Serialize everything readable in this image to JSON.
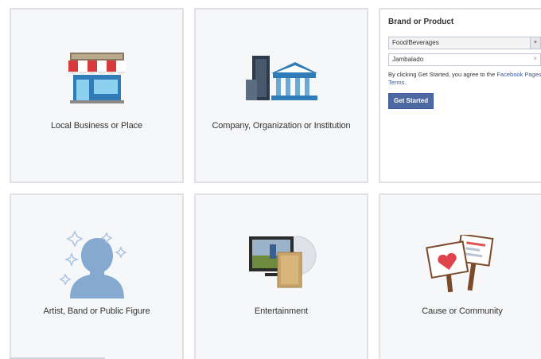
{
  "categories": [
    {
      "label": "Local Business or Place"
    },
    {
      "label": "Company, Organization or Institution"
    },
    {
      "label": "Artist, Band or Public Figure"
    },
    {
      "label": "Entertainment"
    },
    {
      "label": "Cause or Community"
    }
  ],
  "brand_form": {
    "title": "Brand or Product",
    "category_select": "Food/Beverages",
    "name_value": "Jambalado",
    "clear_glyph": "×",
    "terms_prefix": "By clicking Get Started, you agree to the",
    "terms_link": "Facebook Pages Terms",
    "terms_suffix": ".",
    "submit_label": "Get Started",
    "dropdown_glyph": "▾"
  },
  "colors": {
    "tile_bg": "#f6f7f9",
    "tile_border": "#dfe1e6",
    "button_bg": "#4e69a2",
    "link": "#3b5998"
  }
}
